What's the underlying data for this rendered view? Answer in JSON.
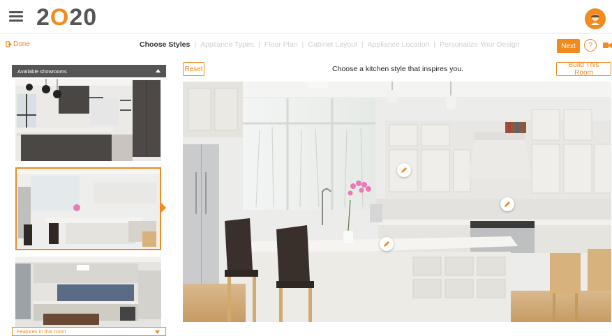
{
  "header": {
    "logo_prefix": "2",
    "logo_o": "O",
    "logo_suffix": "20"
  },
  "stepbar": {
    "done_label": "Done",
    "steps": [
      "Choose Styles",
      "Appliance Types",
      "Floor Plan",
      "Cabinet Layout",
      "Appliance Location",
      "Personalize Your Design"
    ],
    "separator": "|",
    "next_label": "Next",
    "help_label": "?"
  },
  "sidebar": {
    "header_label": "Available showrooms",
    "features_label": "Features in this room"
  },
  "main": {
    "reset_label": "Reset",
    "prompt": "Choose a kitchen style that inspires you.",
    "build_label": "Build This Room"
  },
  "colors": {
    "accent": "#f28a1e",
    "dark": "#555555"
  }
}
